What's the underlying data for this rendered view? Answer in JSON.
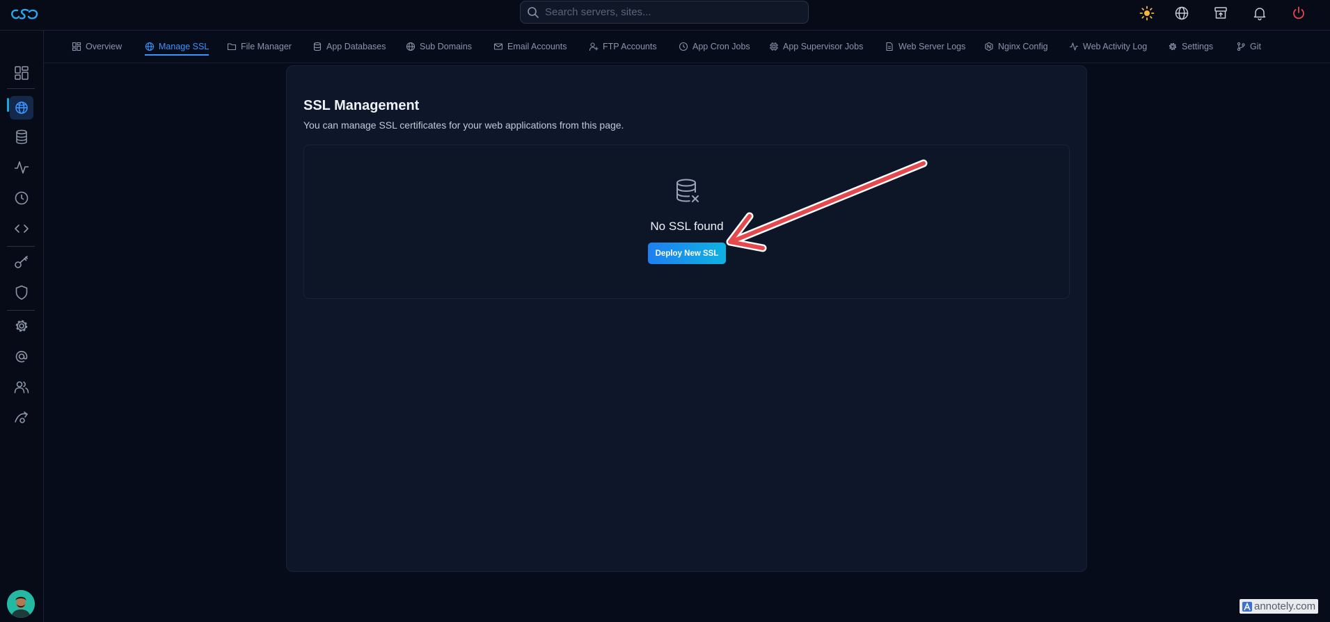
{
  "header": {
    "logo": "logo-icon",
    "search_placeholder": "Search servers, sites...",
    "icons": [
      "sun-icon",
      "globe-icon",
      "archive-icon",
      "bell-icon",
      "power-icon"
    ]
  },
  "sidebar": {
    "items": [
      {
        "icon": "dashboard-icon",
        "active": false
      },
      {
        "icon": "globe-icon",
        "active": true
      },
      {
        "icon": "database-icon",
        "active": false
      },
      {
        "icon": "activity-icon",
        "active": false
      },
      {
        "icon": "clock-icon",
        "active": false
      },
      {
        "icon": "code-icon",
        "active": false
      },
      {
        "icon": "key-icon",
        "active": false
      },
      {
        "icon": "shield-icon",
        "active": false
      },
      {
        "icon": "gear-icon",
        "active": false
      },
      {
        "icon": "at-icon",
        "active": false
      },
      {
        "icon": "users-icon",
        "active": false
      },
      {
        "icon": "route-icon",
        "active": false
      }
    ]
  },
  "tabs": [
    {
      "label": "Overview",
      "icon": "grid-icon",
      "active": false
    },
    {
      "label": "Manage SSL",
      "icon": "globe-icon",
      "active": true
    },
    {
      "label": "File Manager",
      "icon": "folder-icon",
      "active": false
    },
    {
      "label": "App Databases",
      "icon": "database-icon",
      "active": false
    },
    {
      "label": "Sub Domains",
      "icon": "globe-icon",
      "active": false
    },
    {
      "label": "Email Accounts",
      "icon": "mail-icon",
      "active": false
    },
    {
      "label": "FTP Accounts",
      "icon": "user-plus-icon",
      "active": false
    },
    {
      "label": "App Cron Jobs",
      "icon": "clock-icon",
      "active": false
    },
    {
      "label": "App Supervisor Jobs",
      "icon": "cpu-icon",
      "active": false
    },
    {
      "label": "Web Server Logs",
      "icon": "file-icon",
      "active": false
    },
    {
      "label": "Nginx Config",
      "icon": "hexagon-icon",
      "active": false
    },
    {
      "label": "Web Activity Log",
      "icon": "activity-icon",
      "active": false
    },
    {
      "label": "Settings",
      "icon": "gear-icon",
      "active": false
    },
    {
      "label": "Git",
      "icon": "git-icon",
      "active": false
    }
  ],
  "main": {
    "title": "SSL Management",
    "subtitle": "You can manage SSL certificates for your web applications from this page.",
    "empty_state": {
      "icon": "database-x-icon",
      "text": "No SSL found",
      "button_label": "Deploy New SSL"
    }
  },
  "annotation": {
    "type": "arrow",
    "color": "#e5494d",
    "points_to": "Deploy New SSL"
  },
  "watermark": {
    "text": "annotely.com"
  },
  "colors": {
    "accent": "#3b95ff",
    "button_gradient_start": "#1e7ff0",
    "button_gradient_end": "#0fb1e2",
    "background": "#070c1b",
    "card": "#0e1729",
    "power": "#e5484d",
    "sun": "#f5b83d"
  }
}
